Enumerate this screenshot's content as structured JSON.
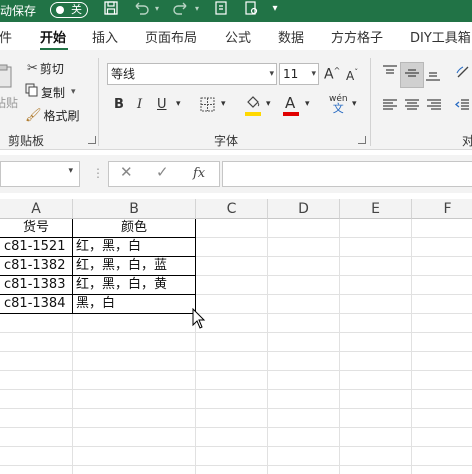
{
  "titlebar": {
    "autosave_label": "自动保存",
    "toggle_state": "关"
  },
  "tabs": [
    "件",
    "开始",
    "插入",
    "页面布局",
    "公式",
    "数据",
    "方方格子",
    "DIY工具箱"
  ],
  "ribbon": {
    "clipboard": {
      "paste": "粘贴",
      "cut": "剪切",
      "copy": "复制",
      "format_painter": "格式刷",
      "group_label": "剪贴板"
    },
    "font": {
      "font_name": "等线",
      "font_size": "11",
      "bold": "B",
      "italic": "I",
      "underline": "U",
      "group_label": "字体",
      "wen": "wén",
      "wen_char": "文"
    },
    "align_group_label": "对"
  },
  "formula_bar": {
    "fx": "fx",
    "cancel": "✕",
    "confirm": "✓"
  },
  "columns": [
    "A",
    "B",
    "C",
    "D",
    "E",
    "F"
  ],
  "table": {
    "header": [
      "货号",
      "颜色"
    ],
    "rows": [
      [
        "c81-1521",
        "红，黑，白"
      ],
      [
        "c81-1382",
        "红，黑，白，蓝"
      ],
      [
        "c81-1383",
        "红，黑，白，黄"
      ],
      [
        "c81-1384",
        "黑，白"
      ]
    ]
  },
  "colors": {
    "title_green": "#217346",
    "highlight_yellow": "#ffd800",
    "font_red": "#e00000"
  }
}
